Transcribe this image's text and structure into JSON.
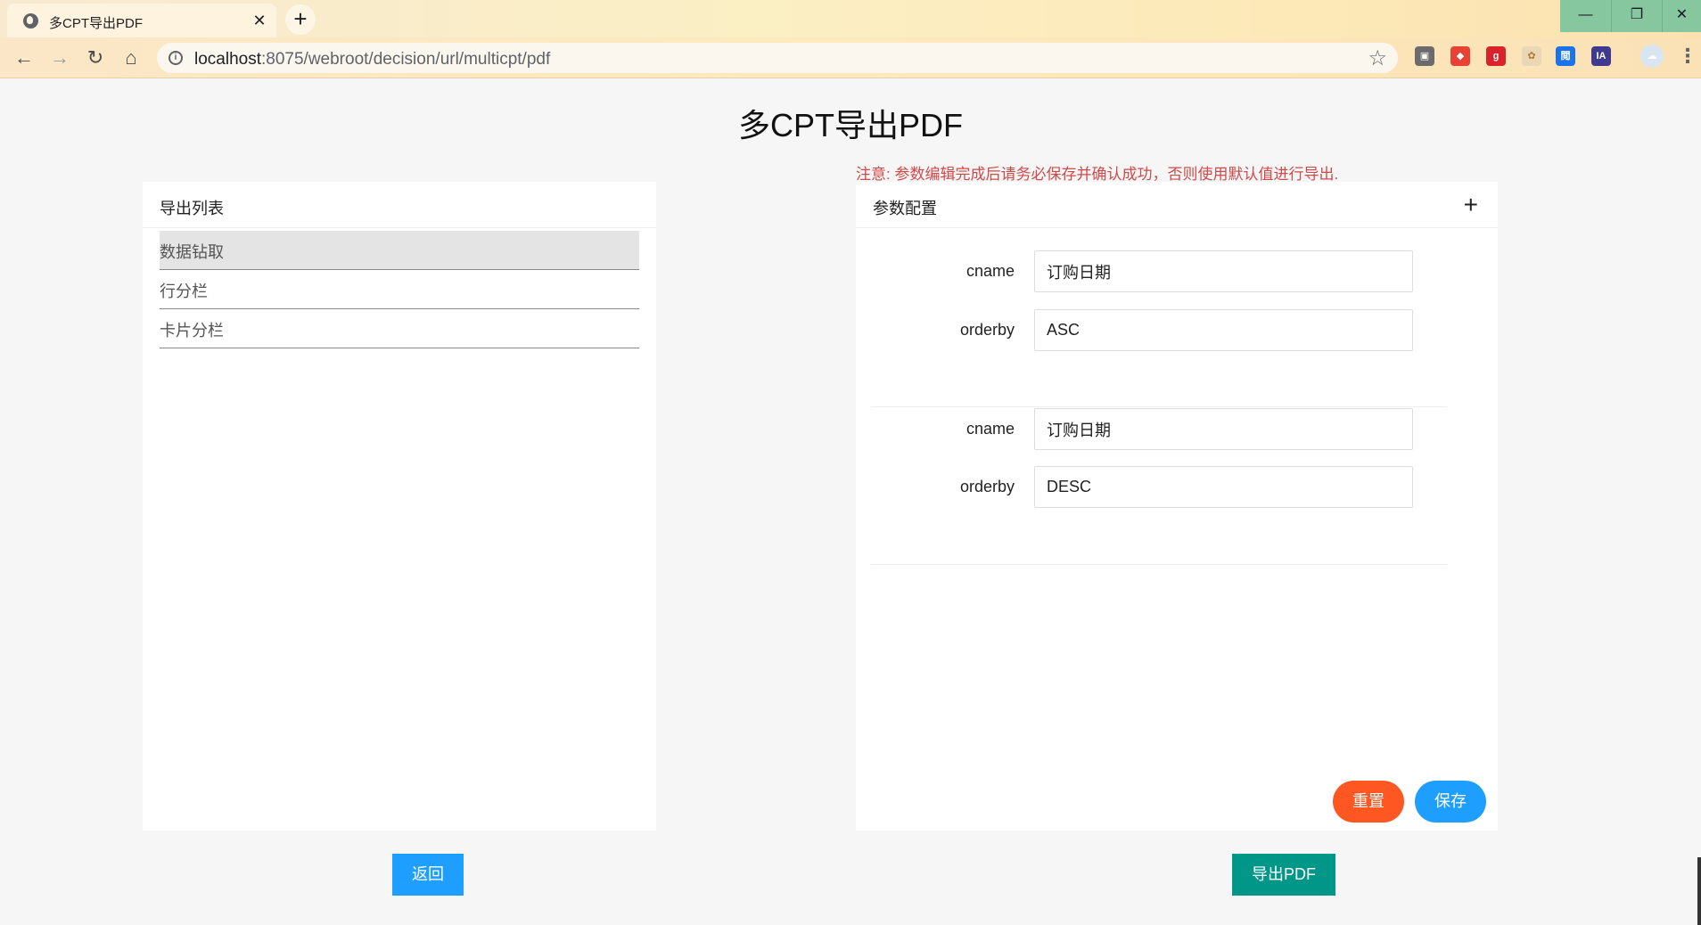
{
  "browser": {
    "tab_title": "多CPT导出PDF",
    "tab_close": "✕",
    "new_tab": "+",
    "url_host": "localhost",
    "url_rest": ":8075/webroot/decision/url/multicpt/pdf",
    "window_controls": [
      "—",
      "❐",
      "✕"
    ],
    "extensions": [
      {
        "name": "extension-1-icon",
        "color": "#6b6b6b",
        "glyph": "▣"
      },
      {
        "name": "extension-2-icon",
        "color": "#e94235",
        "glyph": "◆"
      },
      {
        "name": "extension-3-icon",
        "color": "#d8232a",
        "glyph": "g"
      },
      {
        "name": "extension-4-icon",
        "color": "#e9d7b5",
        "glyph": "✿"
      },
      {
        "name": "extension-5-icon",
        "color": "#1a73e8",
        "glyph": "閲"
      },
      {
        "name": "extension-6-icon",
        "color": "#3f3a8f",
        "glyph": "IA"
      },
      {
        "name": "profile-avatar",
        "color": "#d9e6f2",
        "glyph": "☁"
      }
    ]
  },
  "page": {
    "title": "多CPT导出PDF",
    "notice": "注意: 参数编辑完成后请务必保存并确认成功，否则使用默认值进行导出.",
    "export_list": {
      "heading": "导出列表",
      "items": [
        "数据钻取",
        "行分栏",
        "卡片分栏"
      ],
      "active_index": 0
    },
    "params": {
      "heading": "参数配置",
      "add_icon": "+",
      "groups": [
        {
          "cname_label": "cname",
          "cname_value": "订购日期",
          "orderby_label": "orderby",
          "orderby_value": "ASC"
        },
        {
          "cname_label": "cname",
          "cname_value": "订购日期",
          "orderby_label": "orderby",
          "orderby_value": "DESC"
        }
      ],
      "reset_label": "重置",
      "save_label": "保存"
    },
    "back_label": "返回",
    "export_label": "导出PDF"
  },
  "colors": {
    "reset": "#ff5722",
    "save": "#1e9fff",
    "back": "#1e9fff",
    "export": "#009688",
    "notice": "#d14a4a"
  }
}
